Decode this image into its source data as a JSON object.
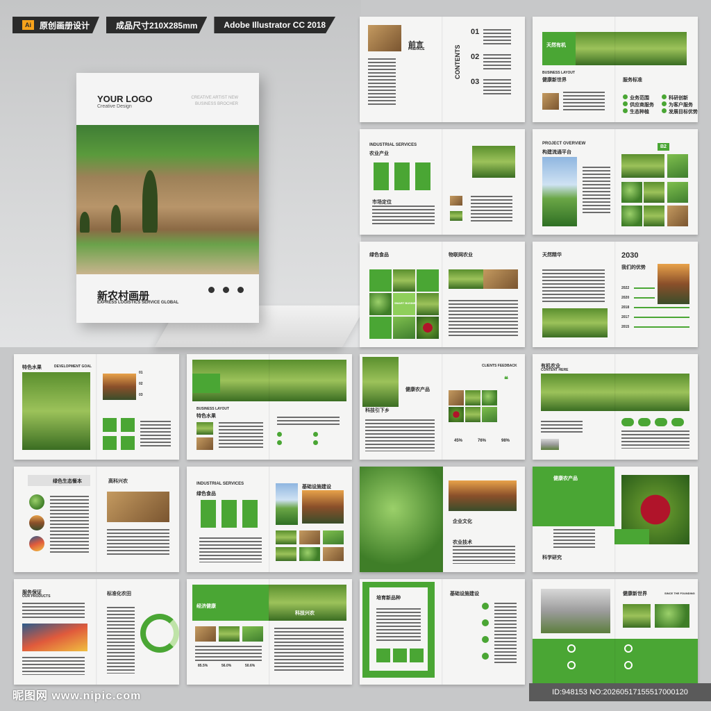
{
  "topbar": {
    "badge": "Ai",
    "tag1": "原创画册设计",
    "tag2": "成品尺寸210X285mm",
    "tag3": "Adobe Illustrator CC 2018"
  },
  "cover": {
    "logo": "YOUR LOGO",
    "logo_sub": "Creative Design",
    "artist": "CREATIVE ARTIST NEW BUSINESS BROCHER",
    "title": "新农村画册",
    "subtitle": "EXPRESS LOGISTICS SERVICE GLOBAL"
  },
  "spreads": {
    "s1": {
      "title": "前言",
      "sub": "PREFACE",
      "contents": "CONTENTS",
      "n1": "01",
      "n2": "02",
      "n3": "03"
    },
    "s2": {
      "title": "天然有机",
      "sub": "BUSINESS LAYOUT",
      "sub2": "健康新世界",
      "i1": "服务标准",
      "i2": "业务范围",
      "i3": "科研创新",
      "i4": "供应商服务",
      "i5": "为客户服务",
      "i6": "生态种植",
      "i7": "发展目标优势"
    },
    "s3": {
      "title": "INDUSTRIAL SERVICES",
      "sub": "农业产业",
      "mid": "市场定位"
    },
    "s4": {
      "title": "PROJECT OVERVIEW",
      "sub": "构建流通平台",
      "code": "B2"
    },
    "s5": {
      "title": "绿色食品",
      "sub": "物联网农业",
      "mid": "SMART BUSINESS"
    },
    "s6": {
      "title": "天然精华",
      "year": "2030",
      "mid": "我们的优势",
      "y1": "2022",
      "y2": "2020",
      "y3": "2018",
      "y4": "2017",
      "y5": "2015"
    },
    "s7": {
      "title": "特色水果",
      "sub": "DEVELOPMENT GOAL",
      "n1": "01",
      "n2": "02",
      "n3": "03"
    },
    "s8": {
      "title": "特色水果",
      "sub": "BUSINESS LAYOUT"
    },
    "s9": {
      "title": "健康农产品",
      "sub": "科技引下乡",
      "mid": "CLIENTS FEEDBACK",
      "p1": "45%",
      "p2": "76%",
      "p3": "98%"
    },
    "s10": {
      "title": "有机农业",
      "sub": "CONTENT HERE"
    },
    "s11": {
      "title": "绿色生态餐本",
      "sub": "高科兴农"
    },
    "s12": {
      "title": "INDUSTRIAL SERVICES",
      "sub": "绿色食品",
      "mid": "基础设施建设"
    },
    "s13": {
      "title": "企业文化",
      "sub": "农业技术"
    },
    "s14": {
      "title": "健康农产品",
      "sub": "科学研究"
    },
    "s15": {
      "title": "服务保证",
      "sub": "OUR PRODUCTS",
      "mid": "标准化农田"
    },
    "s16": {
      "title": "经济健康",
      "sub": "科技兴农",
      "p1": "85.5%",
      "p2": "56.0%",
      "p3": "50.6%"
    },
    "s17": {
      "title": "培育新品种",
      "sub": "基础设施建设"
    },
    "s18": {
      "title": "健康新世界",
      "sub": "SINCE THE FOUNDING"
    }
  },
  "watermark": "昵图网 www.nipic.com",
  "id": "ID:948153 NO:20260517155517000120"
}
